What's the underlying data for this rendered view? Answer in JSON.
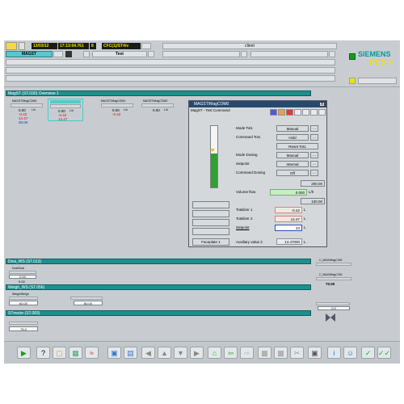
{
  "header": {
    "date": "13/03/12",
    "time": "17:13:04.761",
    "num": "8",
    "cfc": "CFC(1)/ST4/v",
    "client": "client",
    "area_tab": "MAGST",
    "test_tab": "Test",
    "brand_siemens": "SIEMENS",
    "brand_pcs": "PCS 7"
  },
  "plant": {
    "title": "MagST (ST.030) Overview 1",
    "blocks": [
      {
        "name": "MAGST/MagCOM0",
        "v1": "0.00",
        "v2": "-0.42",
        "v3": "14.47",
        "v4": "20.00",
        "unit": "L/h"
      },
      {
        "name": "MAGST/MagCOM0",
        "v1": "0.00",
        "v2": "-0.42",
        "v3": "14.47",
        "v4": "",
        "unit": "L/h"
      },
      {
        "name": "MAGST/MagCOM1",
        "v1": "0.00",
        "v2": "-0.42",
        "v3": "",
        "v4": "",
        "unit": "L/h"
      },
      {
        "name": "MAGST/MagCOM2",
        "v1": "0.00",
        "v2": "",
        "v3": "",
        "v4": "",
        "unit": "L/h"
      }
    ]
  },
  "faceplate": {
    "title": "MAGST/MagCOM0",
    "subtitle": "MagST - Test Command",
    "close": "X",
    "rows": [
      {
        "label": "Mode Tot1",
        "value": "Manual"
      },
      {
        "label": "Command Tot1",
        "value": "Hold"
      },
      {
        "label": "",
        "value": "Reset Tot1"
      },
      {
        "label": "Mode Dosing",
        "value": "Manual"
      },
      {
        "label": "Setpoint",
        "value": "Internal"
      },
      {
        "label": "Command Dosing",
        "value": "Off"
      }
    ],
    "hi_limit": "200.00",
    "volume_flow_label": "Volume flow",
    "volume_flow_value": "0.000",
    "volume_flow_unit": "L/h",
    "lo_limit": "100.00",
    "totalizer1_label": "Totalizer 1",
    "totalizer1_value": "-0.42",
    "totalizer2_label": "Totalizer 2",
    "totalizer2_value": "14.47",
    "setpoint_label": "Setpoint",
    "setpoint_value": "20",
    "unit": "L",
    "faceplate_btn": "Faceplate 1",
    "aux_label": "Auxiliary value 2",
    "aux_value": "14.47000",
    "aux_unit": "L",
    "bar_fill": 0.55
  },
  "sections": [
    {
      "title": "Dosi_WS (ST.013)"
    },
    {
      "title": "Weigh_WS (ST.056)"
    },
    {
      "title": "STmotor (ST.083)"
    }
  ],
  "lower_blocks": [
    {
      "name": "Dosi/Dosi",
      "v1": "0.00",
      "v2": "0.00"
    },
    {
      "name": "Weigh/Weigh",
      "v1": "60.00"
    },
    {
      "name": "",
      "v1": "80.00"
    },
    {
      "name": "",
      "v1": "75.0"
    }
  ],
  "right_blocks": [
    {
      "name": "C_MAG/MagCOM",
      "v1": ""
    },
    {
      "name": "C_MAG/MagCOM",
      "v1": "70.00"
    },
    {
      "name": "",
      "v1": "0.0"
    }
  ],
  "toolbar": {
    "icons": [
      "play-icon",
      "help-icon",
      "folder-icon",
      "grid-icon",
      "trend-icon",
      "report-icon",
      "print-icon",
      "back-icon",
      "up-icon",
      "down-icon",
      "forward-icon",
      "home-icon",
      "prev-picture-icon",
      "next-picture-icon",
      "copy-icon",
      "paste-icon",
      "cut-icon",
      "screen-icon",
      "info-icon",
      "user-icon",
      "ack-icon",
      "ack-all-icon"
    ]
  }
}
